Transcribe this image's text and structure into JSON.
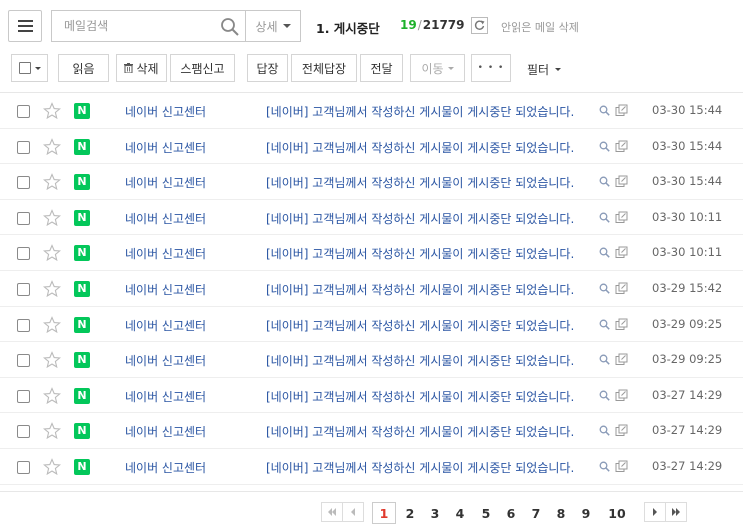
{
  "search": {
    "placeholder": "메일검색",
    "detail_label": "상세"
  },
  "folder": {
    "title": "1. 게시중단",
    "unread": "19",
    "separator": "/",
    "total": "21779",
    "unread_delete_label": "안읽은 메일 삭제"
  },
  "toolbar": {
    "read": "읽음",
    "delete": "삭제",
    "spam": "스팸신고",
    "reply": "답장",
    "reply_all": "전체답장",
    "forward": "전달",
    "move": "이동",
    "more": "• • •",
    "filter": "필터"
  },
  "mails": [
    {
      "sender": "네이버 신고센터",
      "subject": "[네이버] 고객님께서 작성하신 게시물이 게시중단 되었습니다.",
      "date": "03-30 15:44"
    },
    {
      "sender": "네이버 신고센터",
      "subject": "[네이버] 고객님께서 작성하신 게시물이 게시중단 되었습니다.",
      "date": "03-30 15:44"
    },
    {
      "sender": "네이버 신고센터",
      "subject": "[네이버] 고객님께서 작성하신 게시물이 게시중단 되었습니다.",
      "date": "03-30 15:44"
    },
    {
      "sender": "네이버 신고센터",
      "subject": "[네이버] 고객님께서 작성하신 게시물이 게시중단 되었습니다.",
      "date": "03-30 10:11"
    },
    {
      "sender": "네이버 신고센터",
      "subject": "[네이버] 고객님께서 작성하신 게시물이 게시중단 되었습니다.",
      "date": "03-30 10:11"
    },
    {
      "sender": "네이버 신고센터",
      "subject": "[네이버] 고객님께서 작성하신 게시물이 게시중단 되었습니다.",
      "date": "03-29 15:42"
    },
    {
      "sender": "네이버 신고센터",
      "subject": "[네이버] 고객님께서 작성하신 게시물이 게시중단 되었습니다.",
      "date": "03-29 09:25"
    },
    {
      "sender": "네이버 신고센터",
      "subject": "[네이버] 고객님께서 작성하신 게시물이 게시중단 되었습니다.",
      "date": "03-29 09:25"
    },
    {
      "sender": "네이버 신고센터",
      "subject": "[네이버] 고객님께서 작성하신 게시물이 게시중단 되었습니다.",
      "date": "03-27 14:29"
    },
    {
      "sender": "네이버 신고센터",
      "subject": "[네이버] 고객님께서 작성하신 게시물이 게시중단 되었습니다.",
      "date": "03-27 14:29"
    },
    {
      "sender": "네이버 신고센터",
      "subject": "[네이버] 고객님께서 작성하신 게시물이 게시중단 되었습니다.",
      "date": "03-27 14:29"
    }
  ],
  "mail_badge": "N",
  "pagination": {
    "pages": [
      "1",
      "2",
      "3",
      "4",
      "5",
      "6",
      "7",
      "8",
      "9",
      "10"
    ],
    "current": "1"
  },
  "colors": {
    "naver_green": "#03c75a",
    "unread_count": "#1db12b",
    "link_blue": "#2a55a3",
    "current_page": "#e03a2d"
  }
}
